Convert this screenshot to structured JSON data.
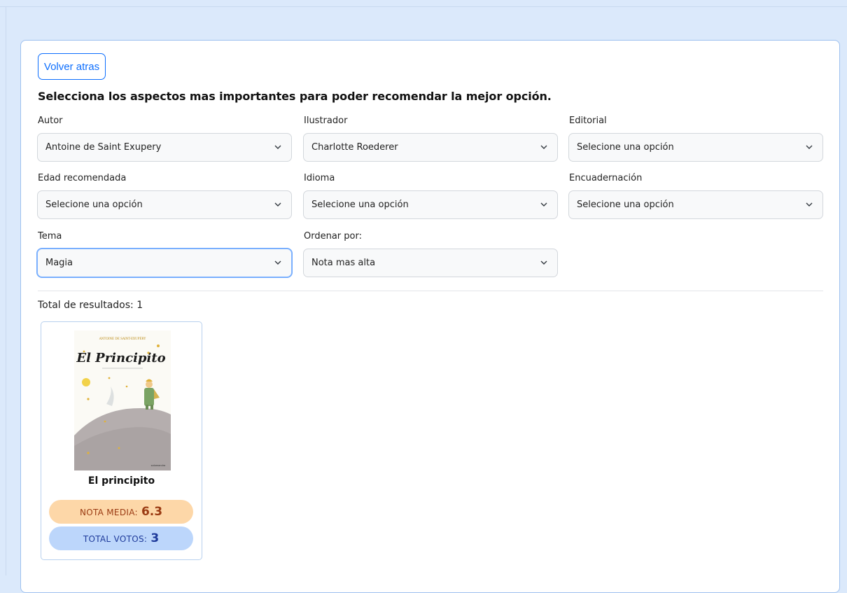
{
  "back_button": {
    "label": "Volver atras"
  },
  "heading": "Selecciona los aspectos mas importantes para poder recomendar la mejor opción.",
  "filters": {
    "autor": {
      "label": "Autor",
      "value": "Antoine de Saint Exupery"
    },
    "ilustrador": {
      "label": "Ilustrador",
      "value": "Charlotte Roederer"
    },
    "editorial": {
      "label": "Editorial",
      "value": "Selecione una opción"
    },
    "edad": {
      "label": "Edad recomendada",
      "value": "Selecione una opción"
    },
    "idioma": {
      "label": "Idioma",
      "value": "Selecione una opción"
    },
    "encuadernacion": {
      "label": "Encuadernación",
      "value": "Selecione una opción"
    },
    "tema": {
      "label": "Tema",
      "value": "Magia"
    },
    "ordenar": {
      "label": "Ordenar por:",
      "value": "Nota mas alta"
    }
  },
  "results": {
    "total_label": "Total de resultados: 1",
    "books": [
      {
        "title": "El principito",
        "cover_author": "ANTOINE DE SAINT-EXUPÉRY",
        "cover_title": "El Principito",
        "rating_label": "NOTA MEDIA:",
        "rating_value": "6.3",
        "votes_label": "TOTAL VOTOS:",
        "votes_value": "3"
      }
    ]
  },
  "colors": {
    "accent": "#0d6efd",
    "rating_bg": "#fdd7a8",
    "votes_bg": "#bcd6fb",
    "page_bg": "#dbe9fb"
  }
}
